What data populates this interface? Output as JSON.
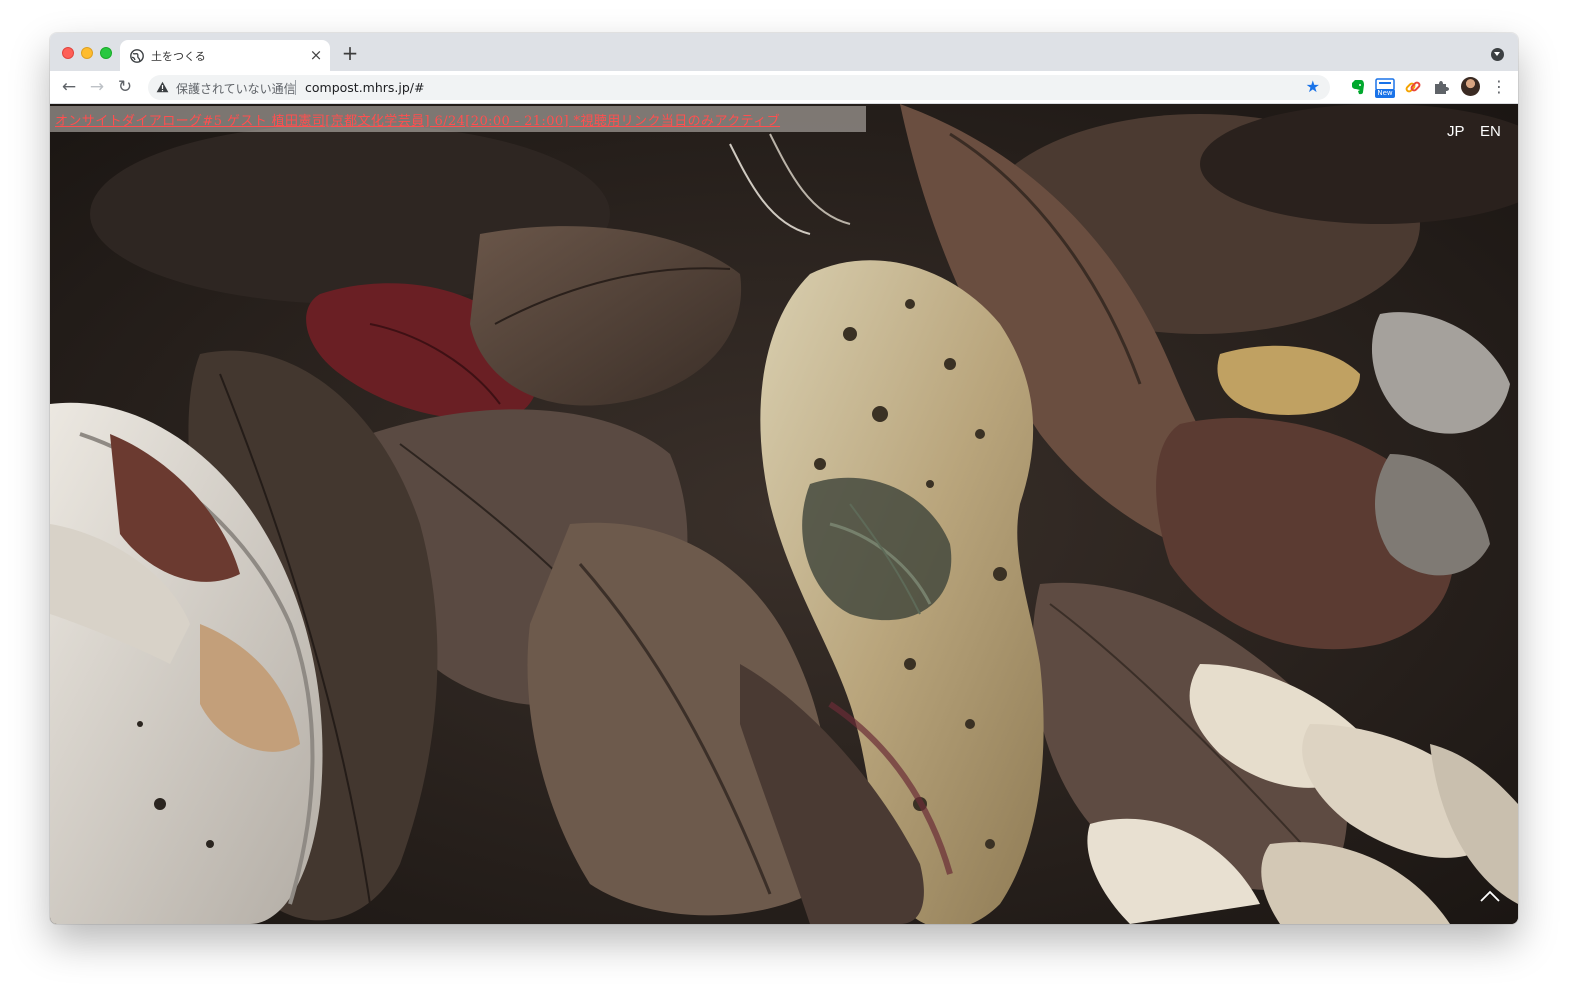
{
  "browser": {
    "tab": {
      "title": "土をつくる",
      "close_glyph": "×"
    },
    "new_tab_glyph": "+",
    "nav": {
      "back_glyph": "←",
      "forward_glyph": "→",
      "reload_glyph": "↻"
    },
    "omnibox": {
      "security_label": "保護されていない通信",
      "url": "compost.mhrs.jp/#",
      "star_glyph": "★"
    },
    "extensions": [
      {
        "name": "evernote-icon"
      },
      {
        "name": "new-extension-icon",
        "badge": "New"
      },
      {
        "name": "link-extension-icon"
      },
      {
        "name": "puzzle-icon"
      }
    ],
    "menu_glyph": "⋮"
  },
  "page": {
    "announcement": "オンサイトダイアローグ#5 ゲスト 植田憲司[京都文化学芸員] 6/24[20:00 - 21:00] *視聴用リンク当日のみアクティブ",
    "lang": {
      "jp": "JP",
      "en": "EN"
    }
  },
  "colors": {
    "announcement_text": "#ff4f4f",
    "star": "#1a73e8",
    "tabstrip_bg": "#dee1e6"
  }
}
